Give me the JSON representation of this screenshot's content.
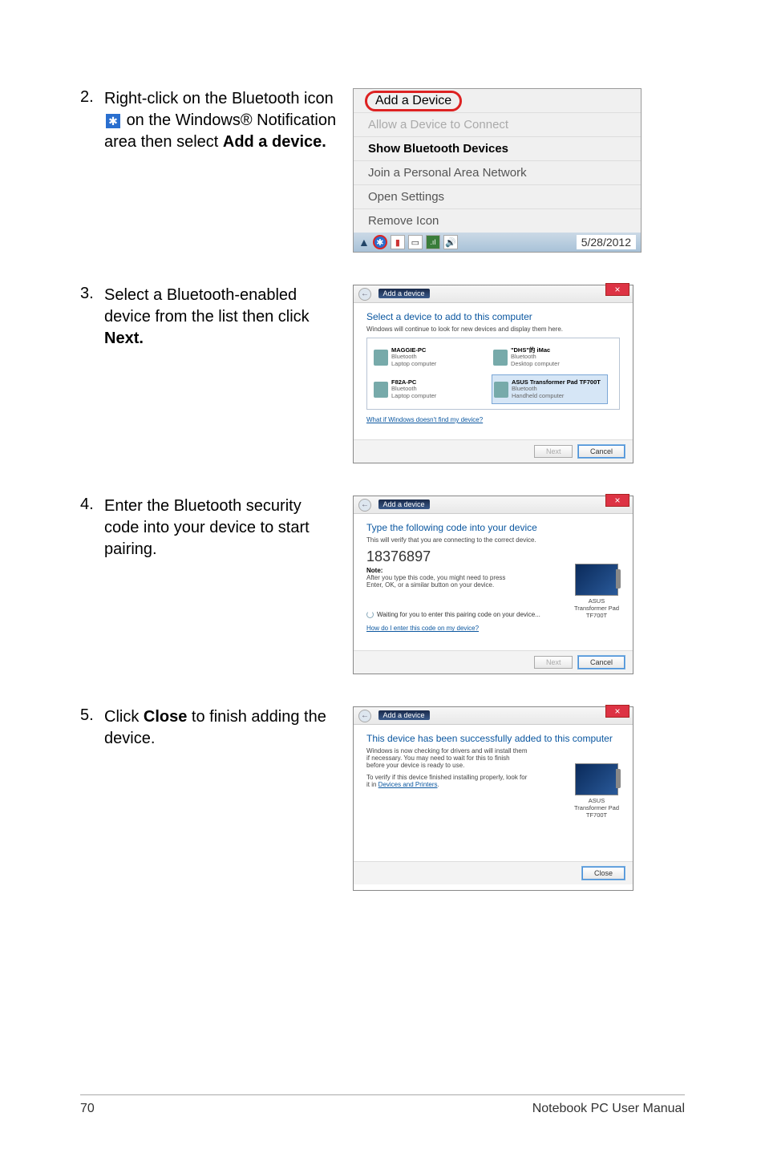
{
  "steps": [
    {
      "num": "2.",
      "text_pre": "Right-click on the Bluetooth icon ",
      "text_mid": " on the Windows® Notification area then select ",
      "bold": "Add a device."
    },
    {
      "num": "3.",
      "text_pre": " Select a Bluetooth-enabled device from the list then click ",
      "bold": "Next."
    },
    {
      "num": "4.",
      "text_pre": "Enter the Bluetooth security code into your device to start pairing."
    },
    {
      "num": "5.",
      "text_pre": "Click ",
      "bold": "Close",
      "text_post": " to finish adding the device."
    }
  ],
  "menu": {
    "items": [
      "Add a Device",
      "Allow a Device to Connect",
      "Show Bluetooth Devices",
      "Join a Personal Area Network",
      "Open Settings",
      "Remove Icon"
    ],
    "date": "5/28/2012"
  },
  "dlg_select": {
    "crumb": "Add a device",
    "heading": "Select a device to add to this computer",
    "sub": "Windows will continue to look for new devices and display them here.",
    "devices": [
      {
        "name": "MAGGIE-PC",
        "t1": "Bluetooth",
        "t2": "Laptop computer"
      },
      {
        "name": "\"DHS\"的 iMac",
        "t1": "Bluetooth",
        "t2": "Desktop computer"
      },
      {
        "name": "F82A-PC",
        "t1": "Bluetooth",
        "t2": "Laptop computer"
      },
      {
        "name": "ASUS Transformer Pad TF700T",
        "t1": "Bluetooth",
        "t2": "Handheld computer",
        "sel": true
      }
    ],
    "link": "What if Windows doesn't find my device?",
    "next": "Next",
    "cancel": "Cancel"
  },
  "dlg_pair": {
    "crumb": "Add a device",
    "heading": "Type the following code into your device",
    "sub": "This will verify that you are connecting to the correct device.",
    "code": "18376897",
    "note_label": "Note:",
    "note": "After you type this code, you might need to press Enter, OK, or a similar button on your device.",
    "device_label": "ASUS Transformer Pad TF700T",
    "waiting": "Waiting for you to enter this pairing code on your device...",
    "link": "How do I enter this code on my device?",
    "next": "Next",
    "cancel": "Cancel"
  },
  "dlg_done": {
    "crumb": "Add a device",
    "heading": "This device has been successfully added to this computer",
    "line1": "Windows is now checking for drivers and will install them if necessary. You may need to wait for this to finish before your device is ready to use.",
    "line2_pre": "To verify if this device finished installing properly, look for it in ",
    "line2_link": "Devices and Printers",
    "device_label": "ASUS Transformer Pad TF700T",
    "close": "Close"
  },
  "footer": {
    "page": "70",
    "title": "Notebook PC User Manual"
  }
}
